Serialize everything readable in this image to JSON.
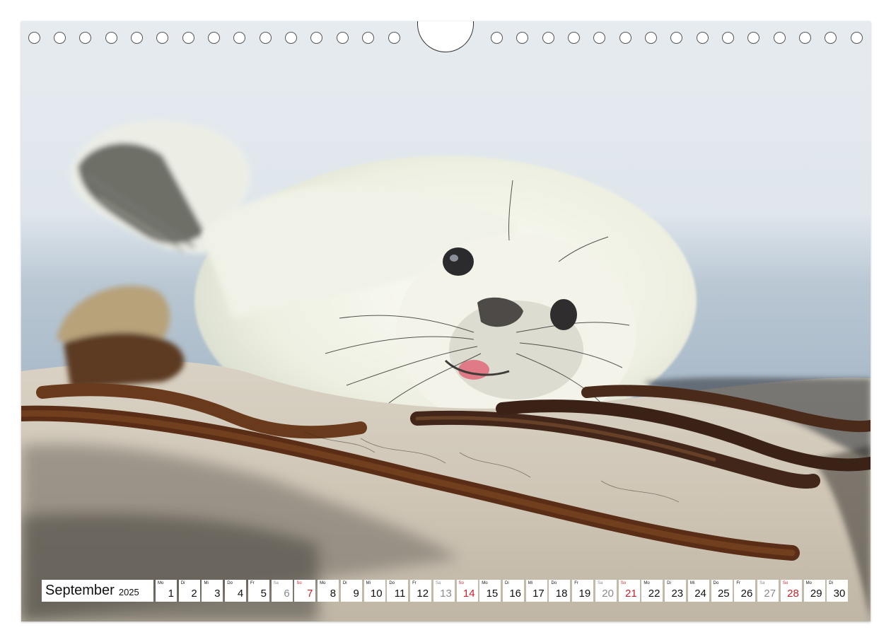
{
  "calendar": {
    "month": "September",
    "year": "2025",
    "days": [
      {
        "wd": "Mo",
        "d": "1",
        "type": "weekday"
      },
      {
        "wd": "Di",
        "d": "2",
        "type": "weekday"
      },
      {
        "wd": "Mi",
        "d": "3",
        "type": "weekday"
      },
      {
        "wd": "Do",
        "d": "4",
        "type": "weekday"
      },
      {
        "wd": "Fr",
        "d": "5",
        "type": "weekday"
      },
      {
        "wd": "Sa",
        "d": "6",
        "type": "sat"
      },
      {
        "wd": "So",
        "d": "7",
        "type": "sun"
      },
      {
        "wd": "Mo",
        "d": "8",
        "type": "weekday"
      },
      {
        "wd": "Di",
        "d": "9",
        "type": "weekday"
      },
      {
        "wd": "Mi",
        "d": "10",
        "type": "weekday"
      },
      {
        "wd": "Do",
        "d": "11",
        "type": "weekday"
      },
      {
        "wd": "Fr",
        "d": "12",
        "type": "weekday"
      },
      {
        "wd": "Sa",
        "d": "13",
        "type": "sat"
      },
      {
        "wd": "So",
        "d": "14",
        "type": "sun"
      },
      {
        "wd": "Mo",
        "d": "15",
        "type": "weekday"
      },
      {
        "wd": "Di",
        "d": "16",
        "type": "weekday"
      },
      {
        "wd": "Mi",
        "d": "17",
        "type": "weekday"
      },
      {
        "wd": "Do",
        "d": "18",
        "type": "weekday"
      },
      {
        "wd": "Fr",
        "d": "19",
        "type": "weekday"
      },
      {
        "wd": "Sa",
        "d": "20",
        "type": "sat"
      },
      {
        "wd": "So",
        "d": "21",
        "type": "sun"
      },
      {
        "wd": "Mo",
        "d": "22",
        "type": "weekday"
      },
      {
        "wd": "Di",
        "d": "23",
        "type": "weekday"
      },
      {
        "wd": "Mi",
        "d": "24",
        "type": "weekday"
      },
      {
        "wd": "Do",
        "d": "25",
        "type": "weekday"
      },
      {
        "wd": "Fr",
        "d": "26",
        "type": "weekday"
      },
      {
        "wd": "Sa",
        "d": "27",
        "type": "sat"
      },
      {
        "wd": "So",
        "d": "28",
        "type": "sun"
      },
      {
        "wd": "Mo",
        "d": "29",
        "type": "weekday"
      },
      {
        "wd": "Di",
        "d": "30",
        "type": "weekday"
      }
    ]
  },
  "colors": {
    "sunday": "#c3232b",
    "saturday": "#8a8a8a",
    "weekday": "#111111"
  }
}
